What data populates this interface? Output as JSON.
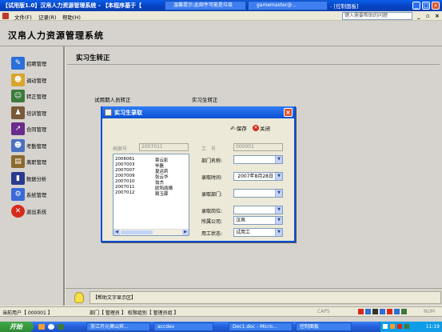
{
  "window": {
    "title": "【试用版1.0】汉帛人力资源管理系统 - 【本程序基于【 ",
    "tab1": "温馨提示:此邮件可能是垃圾",
    "tab2": "gamemaster@...",
    "tab3": "- [控制面板]",
    "min_label": "_",
    "max_label": "□",
    "close_label": "×"
  },
  "menubar": {
    "items": [
      "文件(F)",
      "记录(R)",
      "帮助(H)"
    ],
    "help_placeholder": "键入需要帮助的问题",
    "ctrl_min": "_",
    "ctrl_restore": "▫",
    "ctrl_close": "×"
  },
  "app": {
    "title": "汉帛人力资源管理系统"
  },
  "sidebar": {
    "items": [
      {
        "label": "招聘管理"
      },
      {
        "label": "调动管理"
      },
      {
        "label": "转正管理"
      },
      {
        "label": "培训管理"
      },
      {
        "label": "合同管理"
      },
      {
        "label": "考勤管理"
      },
      {
        "label": "离职管理"
      },
      {
        "label": "数据分析"
      },
      {
        "label": "系统管理"
      },
      {
        "label": "退出系统"
      }
    ]
  },
  "main": {
    "page_title": "实习生转正",
    "section_left": "试用期人员转正",
    "section_right": "实习生转正"
  },
  "dialog": {
    "title": "实习生录取",
    "save_label": "保存",
    "close_label": "关闭",
    "file_no_label": "档案号",
    "file_no_value": "2007011",
    "work_no_label": "工　号",
    "work_no_value": "000001",
    "list": [
      {
        "id": "2006061",
        "name": "章云影"
      },
      {
        "id": "2007003",
        "name": "毕磊"
      },
      {
        "id": "2007007",
        "name": "夏运莉"
      },
      {
        "id": "2007009",
        "name": "张云华"
      },
      {
        "id": "2007010",
        "name": "翁杰"
      },
      {
        "id": "2007011",
        "name": "欧阳函婿"
      },
      {
        "id": "2007012",
        "name": "赖玉薛"
      }
    ],
    "dept_label": "部门名称:",
    "dept_value": "",
    "hire_date_label": "录取时间:",
    "hire_date_value": "2007年8月28日",
    "hire_dept_label": "录取部门:",
    "hire_dept_value": "",
    "hire_post_label": "录取岗位:",
    "hire_post_value": "",
    "company_label": "所属公司:",
    "company_value": "汉帛",
    "emp_status_label": "用工状态:",
    "emp_status_value": "试用工"
  },
  "help": {
    "text": "【帮助文字显示区】"
  },
  "status": {
    "current_user": "当前用户【 000001 】",
    "dept": "部门【 管理员 】 权限组别【 管理员组 】",
    "caps": "CAPS",
    "num": "NUM"
  },
  "taskbar": {
    "start": "开始",
    "tasks": [
      "浙江开元萧山宾...",
      "accdev",
      "Doc1.doc - Micro...",
      "控制面板"
    ],
    "clock": "11:19"
  },
  "colors": {
    "accent": "#0a4fd3",
    "close_red": "#d8502a",
    "panel": "#d6d3ce"
  }
}
